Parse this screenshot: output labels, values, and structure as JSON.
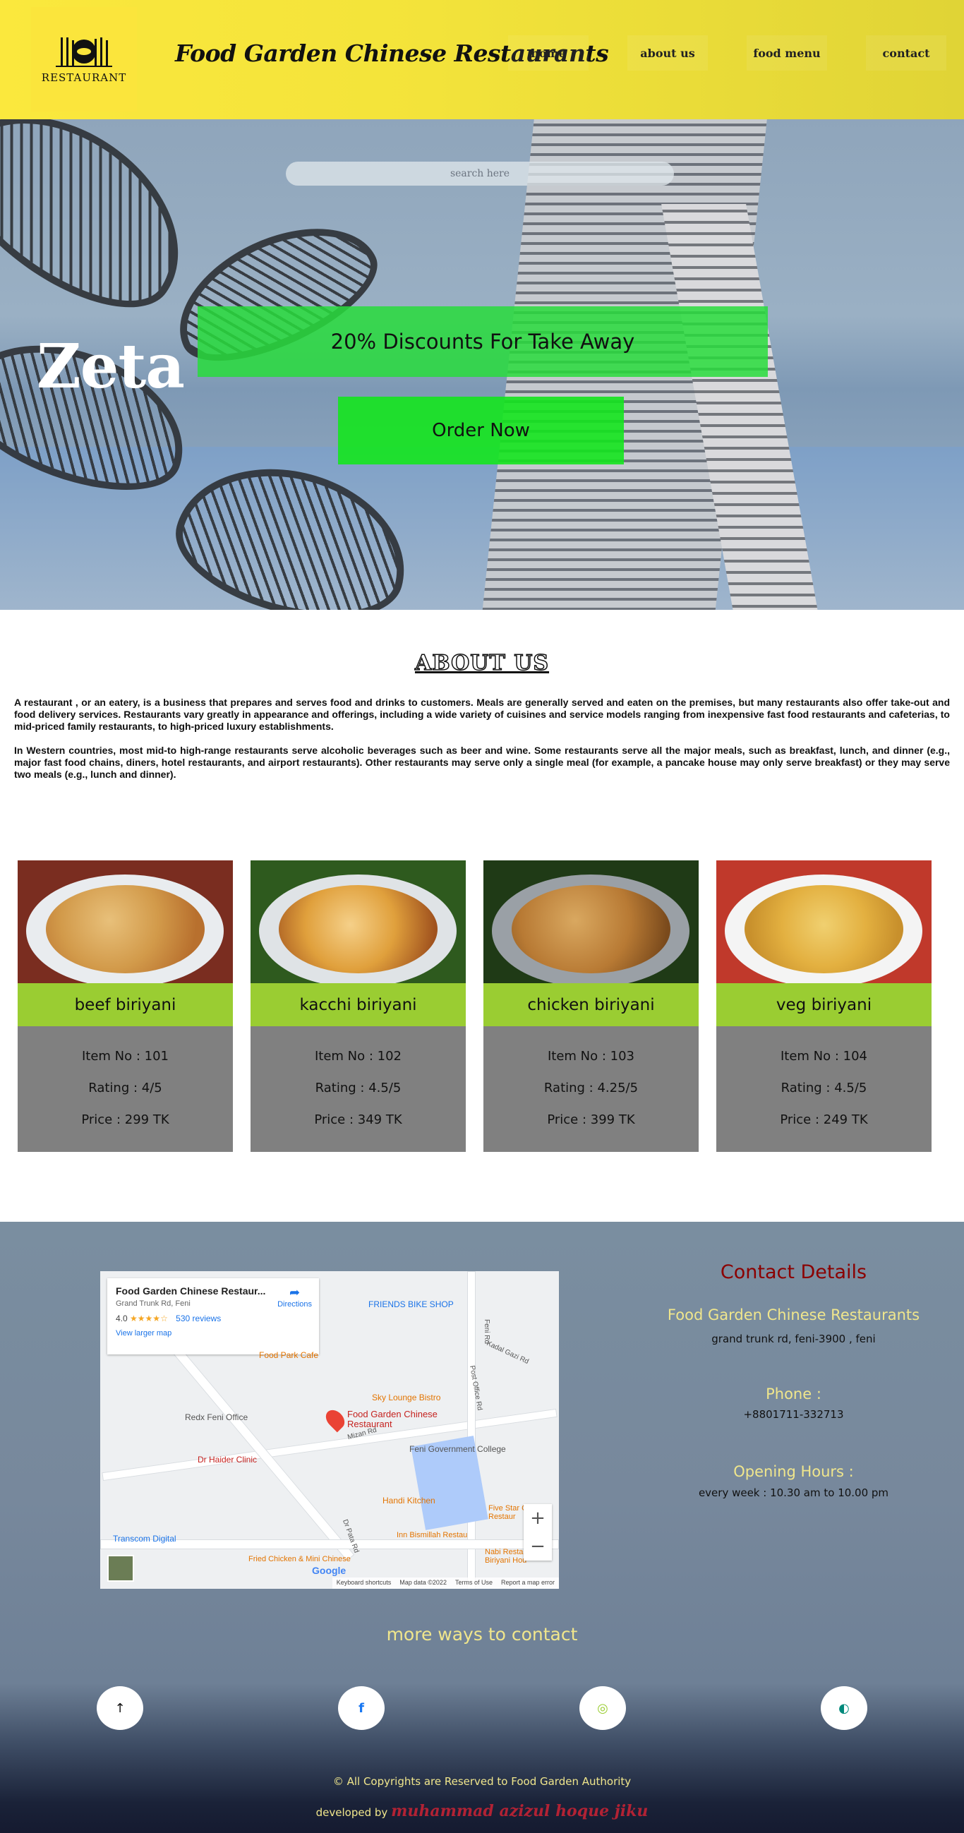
{
  "header": {
    "logo_text": "RESTAURANT",
    "brand": "Food Garden Chinese Restaurants",
    "nav": [
      {
        "label": "home"
      },
      {
        "label": "about us"
      },
      {
        "label": "food menu"
      },
      {
        "label": "contact"
      }
    ]
  },
  "hero": {
    "search_placeholder": "search here",
    "zeta": "Zeta",
    "discount": "20% Discounts For Take Away",
    "order_button": "Order Now"
  },
  "about": {
    "title": "ABOUT US",
    "paragraphs": [
      "A restaurant , or an eatery, is a business that prepares and serves food and drinks to customers. Meals are generally served and eaten on the premises, but many restaurants also offer take-out and food delivery services. Restaurants vary greatly in appearance and offerings, including a wide variety of cuisines and service models ranging from inexpensive fast food restaurants and cafeterias, to mid-priced family restaurants, to high-priced luxury establishments.",
      "In Western countries, most mid-to high-range restaurants serve alcoholic beverages such as beer and wine. Some restaurants serve all the major meals, such as breakfast, lunch, and dinner (e.g., major fast food chains, diners, hotel restaurants, and airport restaurants). Other restaurants may serve only a single meal (for example, a pancake house may only serve breakfast) or they may serve two meals (e.g., lunch and dinner)."
    ]
  },
  "menu": [
    {
      "name": "beef biriyani",
      "item": "Item No : 101",
      "rating": "Rating : 4/5",
      "price": "Price : 299 TK"
    },
    {
      "name": "kacchi biriyani",
      "item": "Item No : 102",
      "rating": "Rating : 4.5/5",
      "price": "Price : 349 TK"
    },
    {
      "name": "chicken biriyani",
      "item": "Item No : 103",
      "rating": "Rating : 4.25/5",
      "price": "Price : 399 TK"
    },
    {
      "name": "veg biriyani",
      "item": "Item No : 104",
      "rating": "Rating : 4.5/5",
      "price": "Price : 249 TK"
    }
  ],
  "map": {
    "place": "Food Garden Chinese Restaur...",
    "address": "Grand Trunk Rd, Feni",
    "rating": "4.0",
    "stars": "★★★★☆",
    "reviews": "530 reviews",
    "larger_map": "View larger map",
    "directions": "Directions",
    "pin_label": "Food Garden Chinese Restaurant",
    "pois": [
      "FRIENDS BIKE SHOP",
      "Food Park Cafe",
      "Sky Lounge Bistro",
      "Redx Feni Office",
      "Feni Government College",
      "Dr Haider Clinic",
      "Handi Kitchen",
      "Five Star Chines Restaur",
      "Inn Bismillah Restau",
      "Nabi Restaurant & Biriyani Hou",
      "Transcom Digital",
      "Fried Chicken & Mini Chinese",
      "Kadal Gazi Rd",
      "Post Office Rd",
      "Mizan Rd",
      "Dr Pata Rd",
      "Feni Rd"
    ],
    "footer": [
      "Keyboard shortcuts",
      "Map data ©2022",
      "Terms of Use",
      "Report a map error"
    ],
    "google": "Google"
  },
  "contact": {
    "title": "Contact Details",
    "name": "Food Garden Chinese Restaurants",
    "address": "grand trunk rd, feni-3900 , feni",
    "phone_label": "Phone :",
    "phone": "+8801711-332713",
    "hours_label": "Opening Hours :",
    "hours": "every week : 10.30 am to 10.00 pm",
    "more": "more ways to contact"
  },
  "footer": {
    "copyright": "© All Copyrights are Reserved to Food Garden Authority",
    "developed_by": "developed by",
    "developer": "muhammad azizul hoque jiku"
  },
  "colors": {
    "header": "#f5e43b",
    "discount": "#28dc3c",
    "card_name": "#9acd32",
    "card_body": "#808080",
    "contact_bg": "#77889c",
    "accent_yellow": "#f0e68c",
    "contact_title": "#8b0000"
  },
  "icons": [
    "restaurant-logo-icon",
    "arrow-up-icon",
    "facebook-icon",
    "instagram-icon",
    "messenger-icon"
  ]
}
